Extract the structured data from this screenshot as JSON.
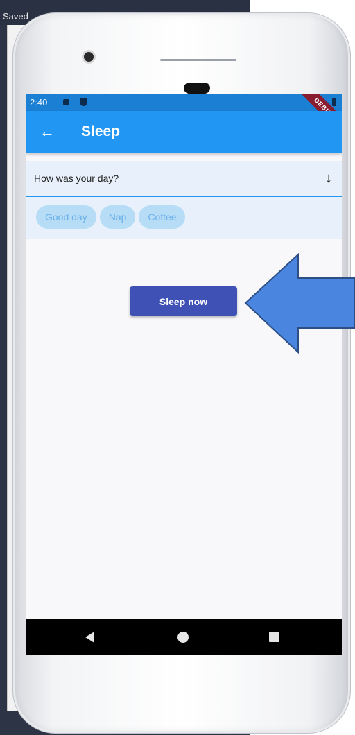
{
  "host": {
    "saved_text": "Saved"
  },
  "status_bar": {
    "time": "2:40"
  },
  "debug_banner": "DEBUG",
  "app_bar": {
    "back_icon": "arrow-back-icon",
    "title": "Sleep"
  },
  "day_question": {
    "label": "How was your day?",
    "dropdown_icon": "arrow-down-icon"
  },
  "chips": [
    {
      "label": "Good day"
    },
    {
      "label": "Nap"
    },
    {
      "label": "Coffee"
    }
  ],
  "primary_action": {
    "label": "Sleep now"
  },
  "colors": {
    "app_bar": "#2196f3",
    "status_bar": "#1b7fd4",
    "button": "#3f51b5",
    "chip_bg": "#b6dcf6",
    "chip_text": "#69b0ea",
    "annotation_arrow": "#4a85e0"
  },
  "nav_bar": {
    "back_icon": "triangle-back-icon",
    "home_icon": "circle-home-icon",
    "recents_icon": "square-recents-icon"
  }
}
